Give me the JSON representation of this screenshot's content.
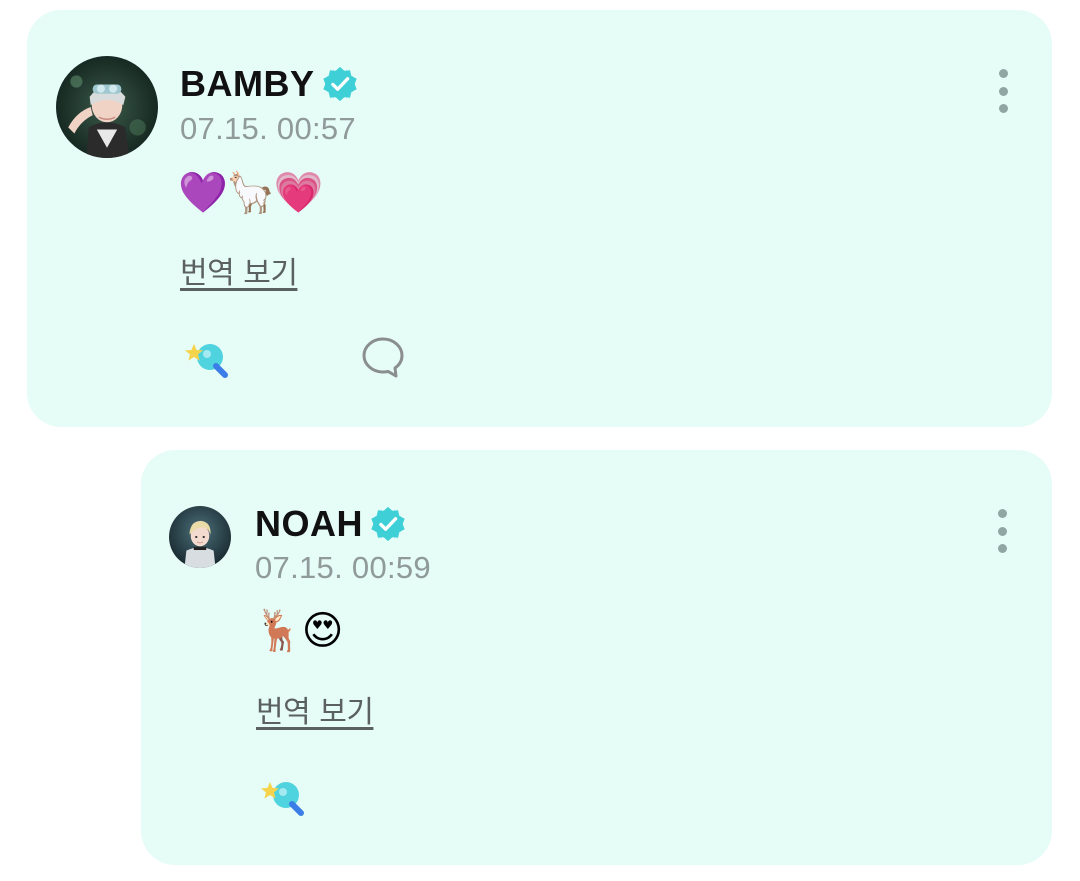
{
  "comments": [
    {
      "author": "BAMBY",
      "verified": true,
      "timestamp": "07.15. 00:57",
      "text": "💜🦙💗",
      "translate_label": "번역 보기",
      "has_comment_button": true
    },
    {
      "author": "NOAH",
      "verified": true,
      "timestamp": "07.15. 00:59",
      "text": "🦌😍",
      "translate_label": "번역 보기",
      "has_comment_button": false
    }
  ],
  "colors": {
    "card_background": "#e6fcf7",
    "verified_badge": "#3fd0d7",
    "timestamp": "#8f9a99",
    "more_dots": "#8fa6a3"
  },
  "icons": {
    "verified": "verified-badge-icon",
    "like": "star-lightstick-icon",
    "comment": "speech-bubble-icon",
    "more": "more-vertical-icon"
  }
}
